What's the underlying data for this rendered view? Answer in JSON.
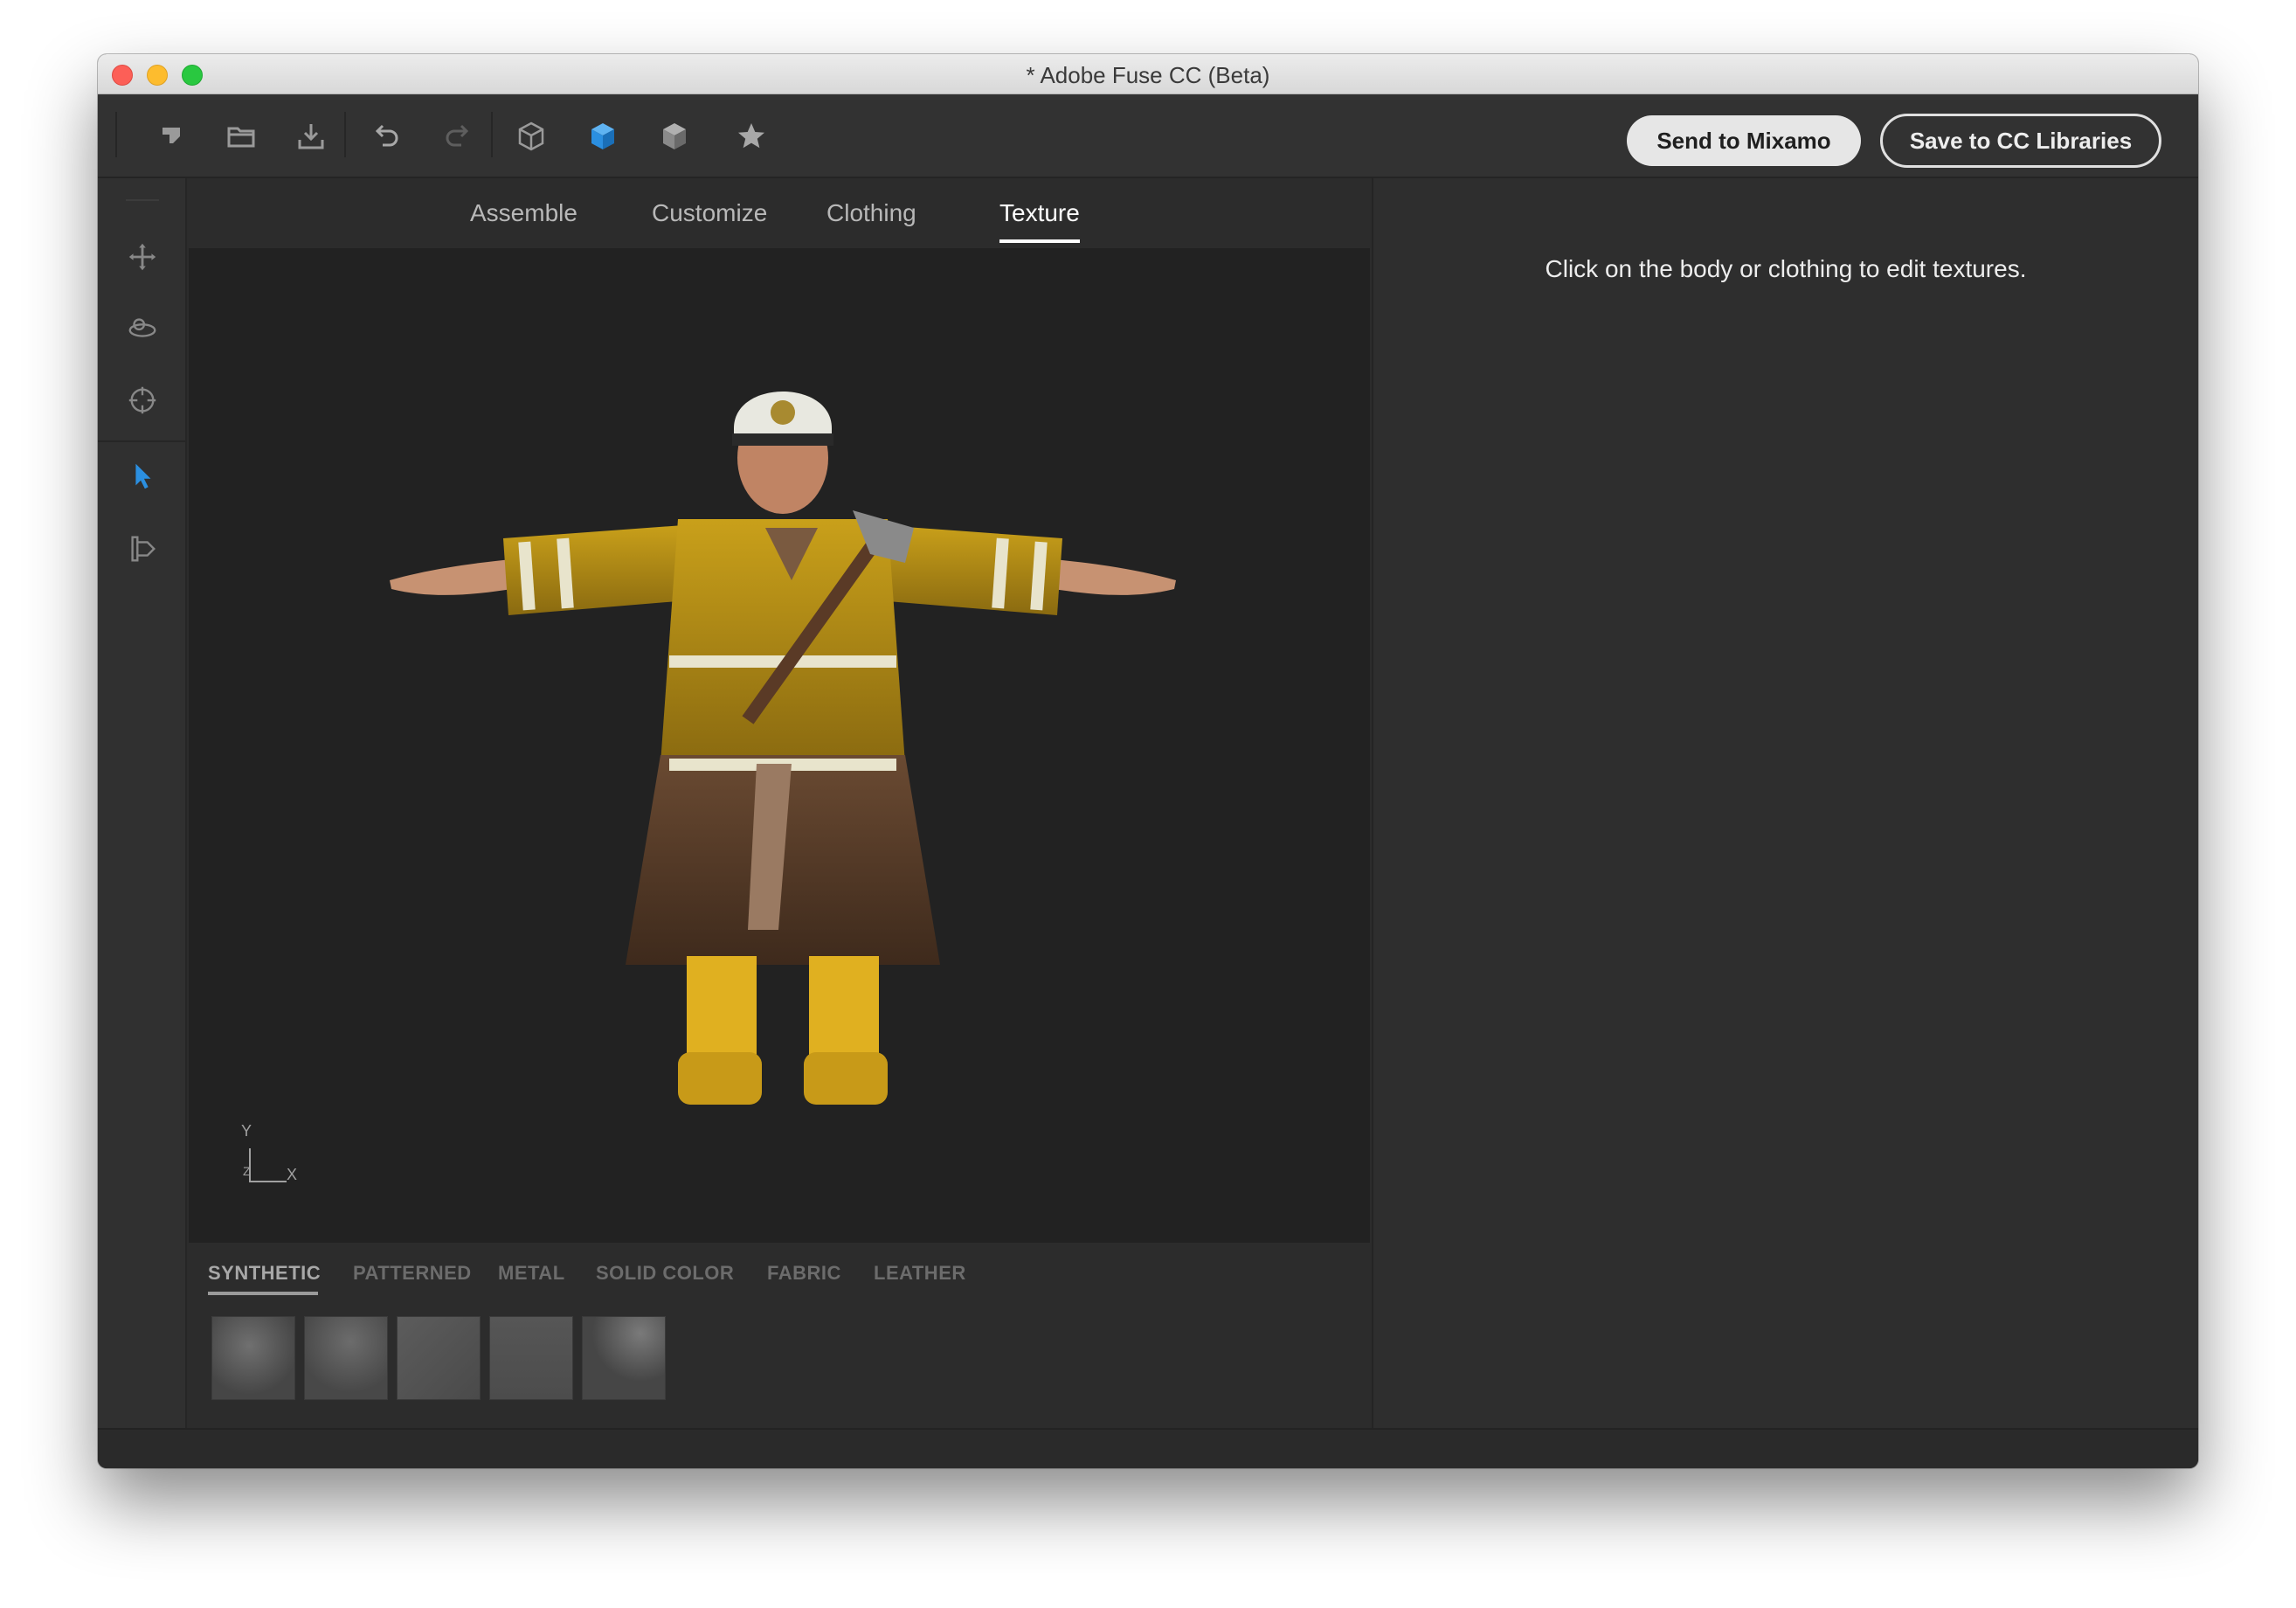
{
  "window": {
    "title": "* Adobe Fuse CC (Beta)"
  },
  "toolbar": {
    "send_label": "Send to Mixamo",
    "save_label": "Save to CC Libraries",
    "icons": [
      "new-icon",
      "open-folder-icon",
      "import-icon",
      "undo-icon",
      "redo-icon",
      "cube-wireframe-icon",
      "cube-shaded-icon",
      "cube-textured-icon",
      "favorite-star-icon"
    ]
  },
  "leftrail": {
    "icons": [
      "pan-move-icon",
      "orbit-icon",
      "target-icon",
      "select-arrow-icon",
      "animate-icon"
    ],
    "active": "select-arrow-icon"
  },
  "tabs": [
    {
      "label": "Assemble"
    },
    {
      "label": "Customize"
    },
    {
      "label": "Clothing"
    },
    {
      "label": "Texture"
    }
  ],
  "active_tab": "Texture",
  "viewport": {
    "axis_y": "Y",
    "axis_x": "X",
    "axis_z": "Z"
  },
  "library": {
    "tabs": [
      "SYNTHETIC",
      "PATTERNED",
      "METAL",
      "SOLID COLOR",
      "FABRIC",
      "LEATHER"
    ],
    "active_tab": "SYNTHETIC",
    "swatch_count": 5
  },
  "right_panel": {
    "hint": "Click on the body or clothing to edit textures."
  },
  "colors": {
    "accent": "#2b8fe0",
    "background": "#2c2c2c",
    "viewport": "#222222"
  }
}
